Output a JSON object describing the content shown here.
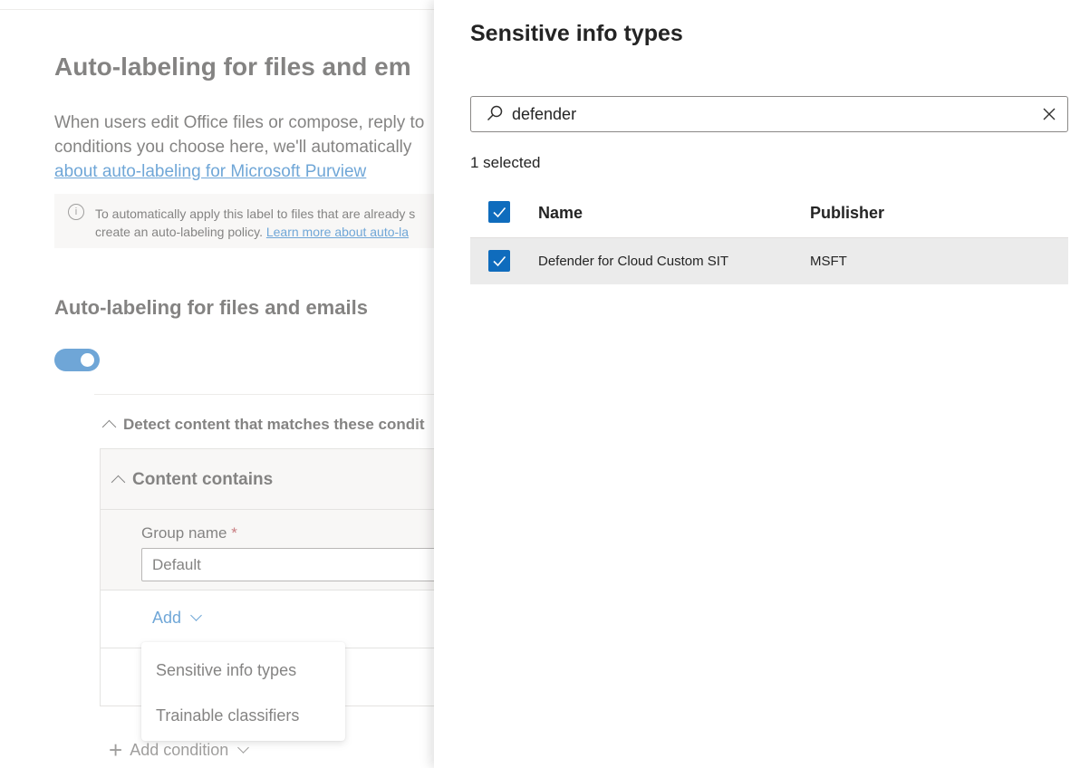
{
  "background": {
    "page_title": "Auto-labeling for files and em",
    "description_lines": [
      "When users edit Office files or compose, reply to",
      "conditions you choose here, we'll automatically",
      "about auto-labeling for Microsoft Purview"
    ],
    "info_lines": [
      "To automatically apply this label to files that are already s",
      "create an auto-labeling policy. ",
      "Learn more about auto-la"
    ],
    "section_title": "Auto-labeling for files and emails",
    "toggle_on": true,
    "detect_label": "Detect content that matches these condit",
    "condition_title": "Content contains",
    "group_name_label": "Group name",
    "group_name_required": "*",
    "group_name_value": "Default",
    "add_label": "Add",
    "add_condition_label": "Add condition",
    "dropdown_items": [
      "Sensitive info types",
      "Trainable classifiers"
    ]
  },
  "panel": {
    "title": "Sensitive info types",
    "search_value": "defender",
    "selected_count": "1 selected",
    "columns": {
      "name": "Name",
      "publisher": "Publisher"
    },
    "rows": [
      {
        "name": "Defender for Cloud Custom SIT",
        "publisher": "MSFT",
        "checked": true
      }
    ]
  },
  "colors": {
    "accent": "#0f6cbd",
    "selected_row": "#ebebeb"
  }
}
